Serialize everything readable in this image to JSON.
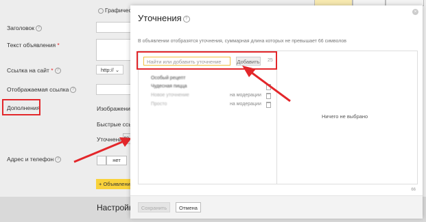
{
  "background": {
    "radio_graphic": "Графическо",
    "labels": {
      "headline": "Заголовок",
      "ad_text": "Текст объявления",
      "site_link": "Ссылка на сайт",
      "display_link": "Отображаемая ссылка",
      "extras": "Дополнения",
      "address_phone": "Адрес и телефон",
      "settings_heading": "Настройк"
    },
    "protocol_select": "http://",
    "extras_items": {
      "images": "Изображения",
      "quick_links": "Быстрые ссылк",
      "refinements": "Уточнения",
      "refinements_btn": "до"
    },
    "toggle_no": "нет",
    "add_ad_button": "+ Объявлени"
  },
  "modal": {
    "title": "Уточнения",
    "description": "В объявлении отобразятся уточнения, суммарная длина которых не превышает 66 символов",
    "search_placeholder": "Найти или добавить уточнение",
    "add_button": "Добавить",
    "counter": "25",
    "items": [
      {
        "name": "Особый рецепт",
        "status": ""
      },
      {
        "name": "Чудесная пицца",
        "status": ""
      },
      {
        "name": "Новое уточнение",
        "status": "на модерации"
      },
      {
        "name": "Просто",
        "status": "на модерации"
      }
    ],
    "empty_text": "Ничего не выбрано",
    "corner_counter": "66",
    "save_button": "Сохранить",
    "cancel_button": "Отмена",
    "close": "×"
  },
  "colors": {
    "highlight_red": "#e3262a",
    "accent_yellow": "#f9d23b"
  }
}
